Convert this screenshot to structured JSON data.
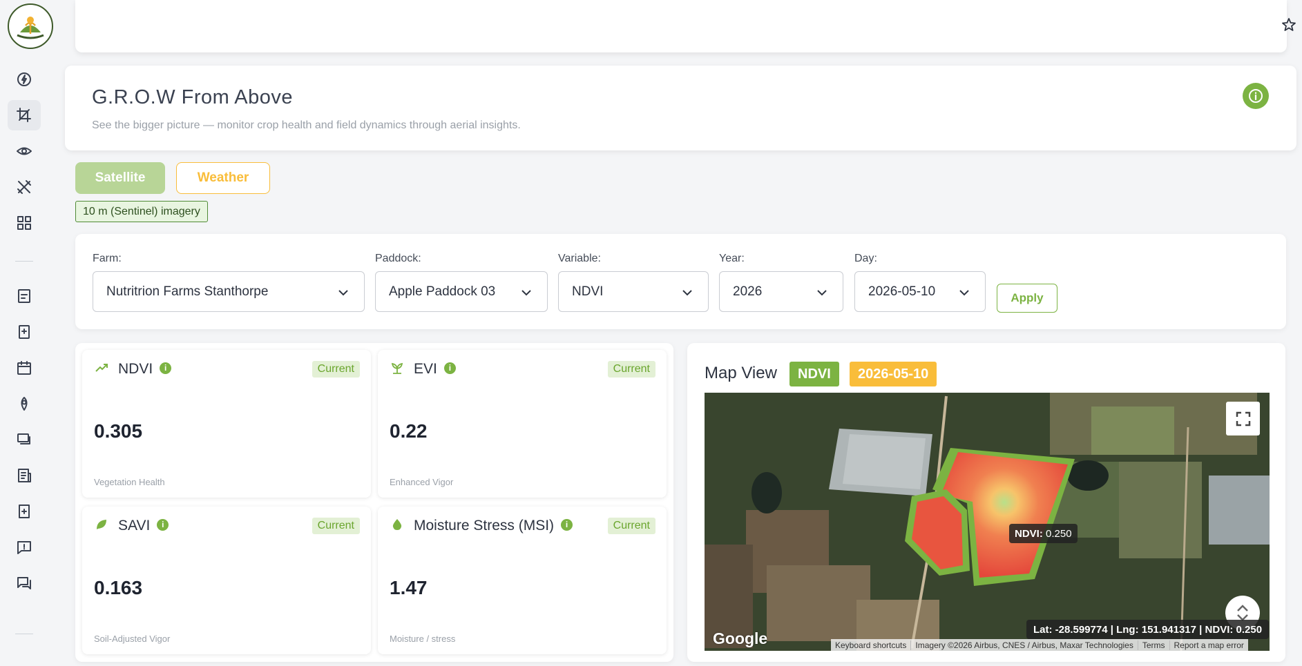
{
  "header": {
    "title": "G.R.O.W From Above",
    "subtitle": "See the bigger picture — monitor crop health and field dynamics through aerial insights."
  },
  "tabs": [
    {
      "label": "Satellite",
      "active": true
    },
    {
      "label": "Weather",
      "active": false
    }
  ],
  "imagery_badge": "10 m (Sentinel) imagery",
  "filters": {
    "farm_label": "Farm:",
    "farm_value": "Nutritrion Farms Stanthorpe",
    "paddock_label": "Paddock:",
    "paddock_value": "Apple Paddock 03",
    "variable_label": "Variable:",
    "variable_value": "NDVI",
    "year_label": "Year:",
    "year_value": "2026",
    "day_label": "Day:",
    "day_value": "2026-05-10",
    "apply_label": "Apply"
  },
  "metrics": [
    {
      "name": "NDVI",
      "badge": "Current",
      "value": "0.305",
      "description": "Vegetation Health",
      "icon": "trending-up-icon"
    },
    {
      "name": "EVI",
      "badge": "Current",
      "value": "0.22",
      "description": "Enhanced Vigor",
      "icon": "sprout-icon"
    },
    {
      "name": "SAVI",
      "badge": "Current",
      "value": "0.163",
      "description": "Soil-Adjusted Vigor",
      "icon": "leaf-icon"
    },
    {
      "name": "Moisture Stress (MSI)",
      "badge": "Current",
      "value": "1.47",
      "description": "Moisture / stress",
      "icon": "droplet-icon"
    }
  ],
  "map": {
    "title": "Map View",
    "variable_tag": "NDVI",
    "date_tag": "2026-05-10",
    "tooltip_label": "NDVI:",
    "tooltip_value": "0.250",
    "coords_text": "Lat: -28.599774 | Lng: 151.941317 | NDVI: 0.250",
    "google_logo": "Google",
    "attribution": {
      "shortcuts": "Keyboard shortcuts",
      "imagery": "Imagery ©2026 Airbus, CNES / Airbus, Maxar Technologies",
      "terms": "Terms",
      "report": "Report a map error"
    }
  },
  "colors": {
    "accent_green": "#7cb342",
    "accent_yellow": "#f9bd3a",
    "tab_active_bg": "#b8d597"
  }
}
